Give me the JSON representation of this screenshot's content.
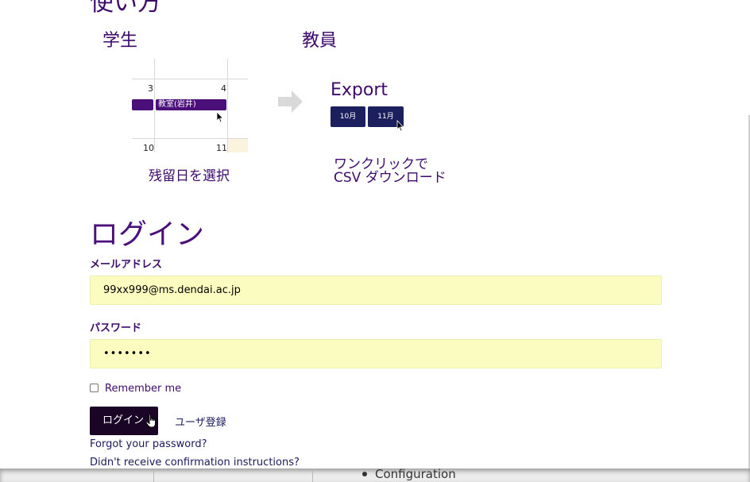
{
  "usage": {
    "heading": "使い方"
  },
  "student": {
    "title": "学生",
    "calendar": {
      "day_top_left": "3",
      "day_top_right": "4",
      "day_bottom_left": "10",
      "day_bottom_right": "11",
      "event_label": "教室(岩井)"
    },
    "caption": "残留日を選択"
  },
  "teacher": {
    "title": "教員",
    "export_title": "Export",
    "months": [
      "10月",
      "11月"
    ],
    "caption_line1": "ワンクリックで",
    "caption_line2": "CSV ダウンロード"
  },
  "login": {
    "title": "ログイン",
    "email_label": "メールアドレス",
    "email_value": "99xx999@ms.dendai.ac.jp",
    "password_label": "パスワード",
    "password_value": "•••••••",
    "remember_label": "Remember me",
    "remember_checked": false,
    "submit_label": "ログイン",
    "register_link": "ユーザ登録",
    "forgot_link": "Forgot your password?",
    "confirm_link": "Didn't receive confirmation instructions?"
  },
  "background_window": {
    "list_item": "Configuration"
  },
  "colors": {
    "accent": "#4b0f7a",
    "input_bg": "#fbfdc0",
    "button_bg": "#1a0527",
    "month_btn": "#1b1f5e"
  }
}
